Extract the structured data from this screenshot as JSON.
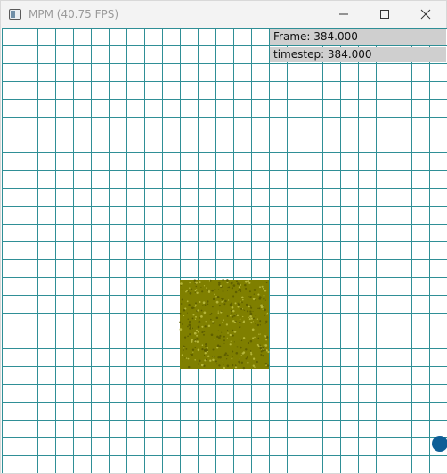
{
  "window": {
    "title": "MPM (40.75 FPS)",
    "icon": "app-window-icon",
    "controls": [
      "minimize-icon",
      "maximize-icon",
      "close-icon"
    ]
  },
  "hud": {
    "frame_label": "Frame: 384.000",
    "timestep_label": "timestep: 384.000"
  },
  "scene": {
    "grid_color": "#2f8f96",
    "grid_cells": 25,
    "particle_color": "#7f7f00",
    "body_color": "#0f5e96"
  }
}
